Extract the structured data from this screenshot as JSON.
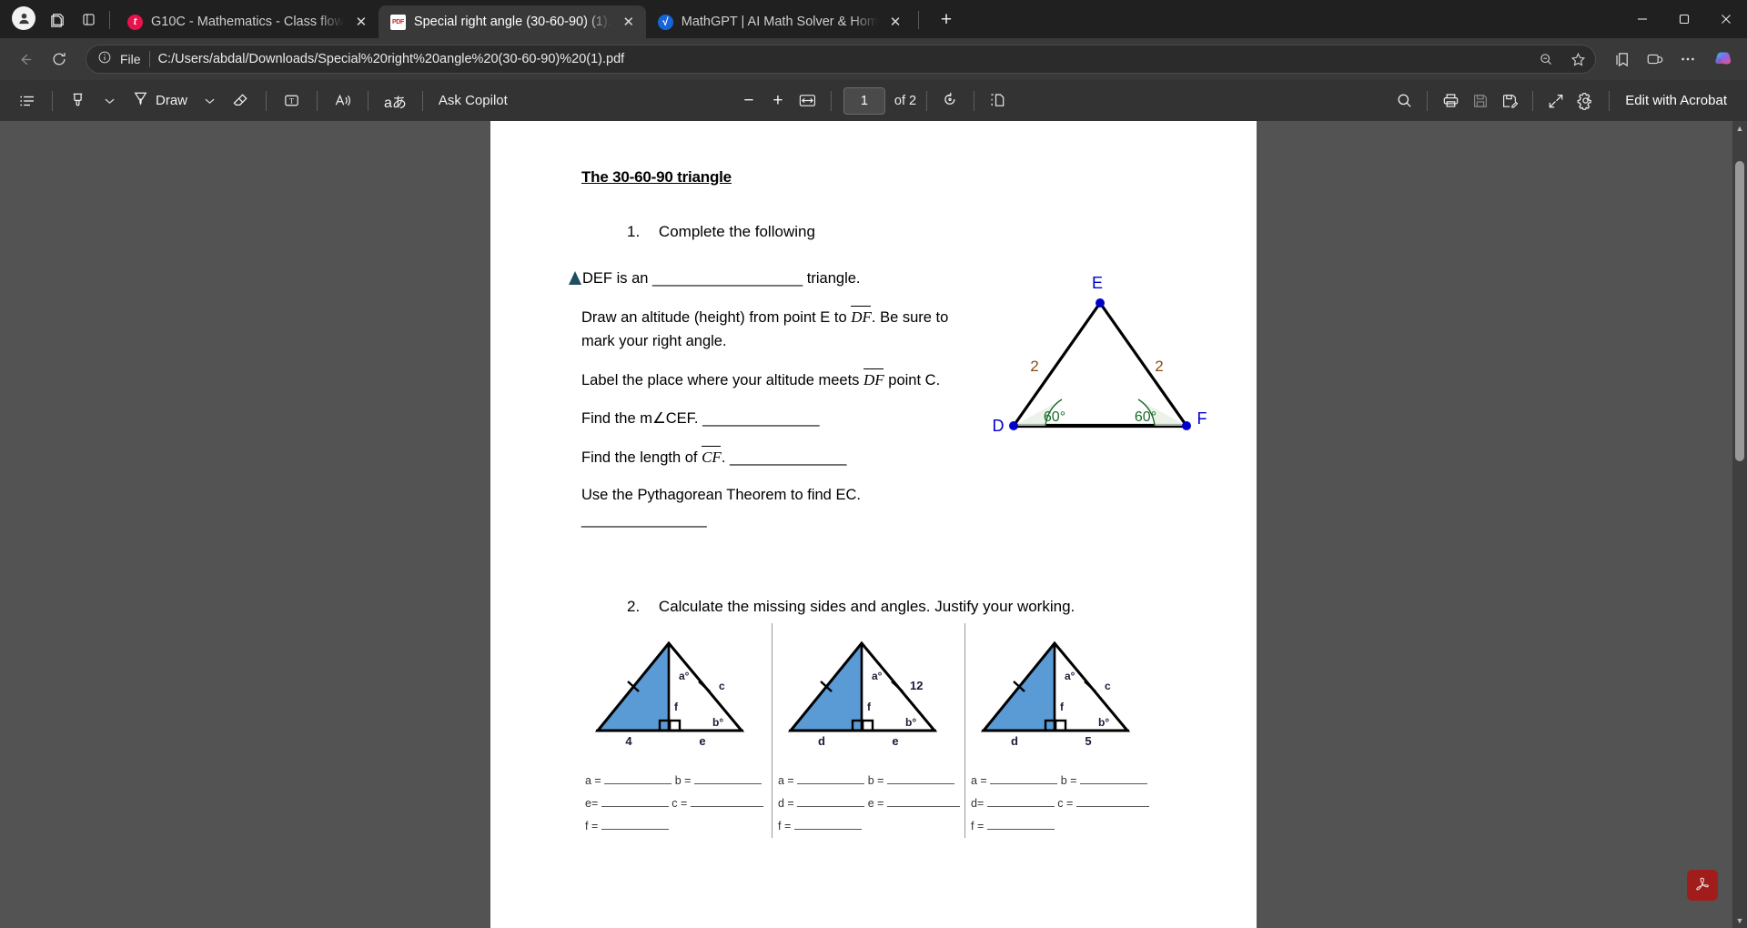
{
  "browser": {
    "tabs": [
      {
        "title": "G10C - Mathematics - Class flow",
        "favicon": "teams-icon",
        "favicon_letter": "t",
        "active": false
      },
      {
        "title": "Special right angle (30-60-90) (1).",
        "favicon": "pdf-icon",
        "favicon_letter": "PDF",
        "active": true
      },
      {
        "title": "MathGPT | AI Math Solver & Hom",
        "favicon": "mathgpt-icon",
        "favicon_letter": "√",
        "active": false
      }
    ],
    "new_tab_label": "+",
    "window_controls": {
      "minimize": "–",
      "maximize": "❐",
      "close": "✕"
    },
    "address": {
      "scheme_label": "File",
      "url": "C:/Users/abdal/Downloads/Special%20right%20angle%20(30-60-90)%20(1).pdf",
      "info_icon": "info-icon",
      "zoom_icon": "search-minus-icon",
      "favorite_icon": "star-icon",
      "collections_icon": "collections-icon",
      "split_icon": "browser-essentials-icon",
      "settings_icon": "ellipsis-icon",
      "copilot_icon": "copilot-icon"
    },
    "nav": {
      "back": "back-arrow",
      "refresh": "refresh-icon"
    }
  },
  "pdf_toolbar": {
    "left": [
      {
        "name": "toc",
        "icon": "list-icon",
        "label": ""
      },
      {
        "name": "highlight",
        "icon": "highlighter-icon",
        "label": ""
      },
      {
        "name": "highlight-chevron",
        "icon": "chevron-down-icon",
        "label": ""
      },
      {
        "name": "draw",
        "icon": "pen-icon",
        "label": "Draw"
      },
      {
        "name": "draw-chevron",
        "icon": "chevron-down-icon",
        "label": ""
      },
      {
        "name": "erase",
        "icon": "eraser-icon",
        "label": ""
      },
      {
        "name": "text",
        "icon": "add-text-icon",
        "label": ""
      },
      {
        "name": "read-aloud",
        "icon": "read-aloud-icon",
        "label": ""
      },
      {
        "name": "translate",
        "icon": "translate-icon",
        "label": ""
      }
    ],
    "ask_copilot_label": "Ask Copilot",
    "zoom_out_label": "−",
    "zoom_in_label": "+",
    "fit_page_icon": "fit-to-width-icon",
    "page_current": "1",
    "page_total_label": "of 2",
    "rotate_icon": "rotate-icon",
    "layout_icon": "page-view-icon",
    "right": [
      {
        "name": "search",
        "icon": "search-icon"
      },
      {
        "name": "print",
        "icon": "print-icon"
      },
      {
        "name": "save",
        "icon": "save-icon",
        "disabled": true
      },
      {
        "name": "save-as",
        "icon": "save-as-icon"
      },
      {
        "name": "fullscreen",
        "icon": "expand-icon"
      },
      {
        "name": "settings",
        "icon": "gear-icon"
      }
    ],
    "edit_with_acrobat_label": "Edit with Acrobat"
  },
  "document": {
    "title": "The 30-60-90 triangle",
    "question1": {
      "number": "1.",
      "text": "Complete the following"
    },
    "q1_lines": [
      {
        "prefix_triangle": true,
        "parts": [
          "DEF is an ",
          "__________________",
          " triangle."
        ]
      },
      {
        "text_a": "Draw an altitude (height) from point E to ",
        "italic": "DF",
        "text_b": ". Be sure to mark your right angle."
      },
      {
        "text_a": "Label the place where your altitude meets ",
        "italic": "DF",
        "text_b": " point C."
      },
      {
        "text_a": "Find the m∠CEF. ______________",
        "italic": "",
        "text_b": ""
      },
      {
        "text_a": "Find the length of ",
        "italic": "CF",
        "text_b": ". ______________"
      },
      {
        "text_a": "Use the Pythagorean Theorem to find EC. _______________",
        "italic": "",
        "text_b": ""
      }
    ],
    "def_figure": {
      "vertices": {
        "D": "D",
        "E": "E",
        "F": "F"
      },
      "side_left_label": "2",
      "side_right_label": "2",
      "angle_d_label": "60°",
      "angle_f_label": "60°"
    },
    "question2": {
      "number": "2.",
      "text": "Calculate the missing sides and angles. Justify your working."
    },
    "triangles": [
      {
        "id": "triangle-1",
        "labels": {
          "a": "a°",
          "b": "b°",
          "c": "c",
          "f": "f",
          "base_left": "4",
          "base_right": "e"
        },
        "answers": [
          [
            "a = ",
            "b = "
          ],
          [
            "e= ",
            "c = "
          ],
          [
            "f = "
          ]
        ]
      },
      {
        "id": "triangle-2",
        "labels": {
          "a": "a°",
          "b": "b°",
          "c": "12",
          "f": "f",
          "base_left": "d",
          "base_right": "e"
        },
        "answers": [
          [
            "a = ",
            "b = "
          ],
          [
            "d = ",
            "e = "
          ],
          [
            "f = "
          ]
        ]
      },
      {
        "id": "triangle-3",
        "labels": {
          "a": "a°",
          "b": "b°",
          "c": "c",
          "f": "f",
          "base_left": "d",
          "base_right": "5"
        },
        "answers": [
          [
            "a = ",
            "b = "
          ],
          [
            "d= ",
            "c = "
          ],
          [
            "f = "
          ]
        ]
      }
    ]
  },
  "colors": {
    "triangle_fill": "#5b9bd5",
    "vertex_blue": "#0000cc",
    "angle_green": "#1a6b2a",
    "side_label_orange": "#8a4b10",
    "acrobat_red": "#a11d1b"
  }
}
